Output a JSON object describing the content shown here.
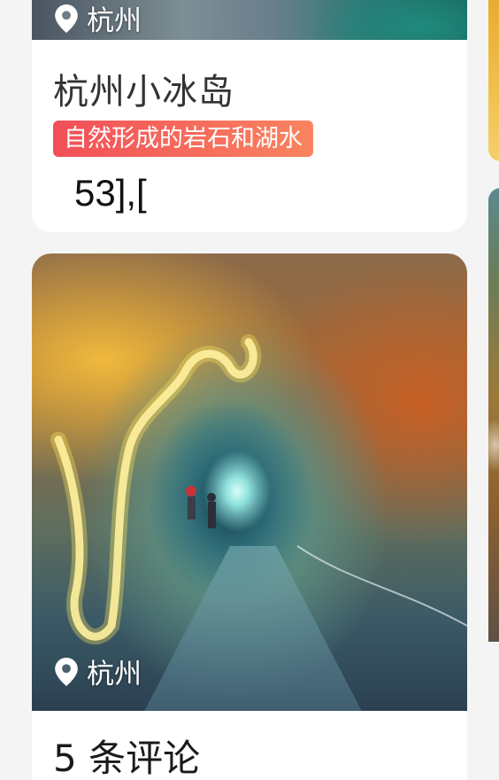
{
  "cards": [
    {
      "location": "杭州",
      "title": "杭州小冰岛",
      "tag": "自然形成的岩石和湖水",
      "raw_text": "53],["
    },
    {
      "location": "杭州",
      "comments": "5 条评论"
    }
  ],
  "icons": {
    "location": "location-pin-icon"
  },
  "colors": {
    "background": "#f4f4f4",
    "card": "#ffffff",
    "tag_gradient_start": "#f24f58",
    "tag_gradient_end": "#fa845f",
    "title_text": "#333333"
  }
}
